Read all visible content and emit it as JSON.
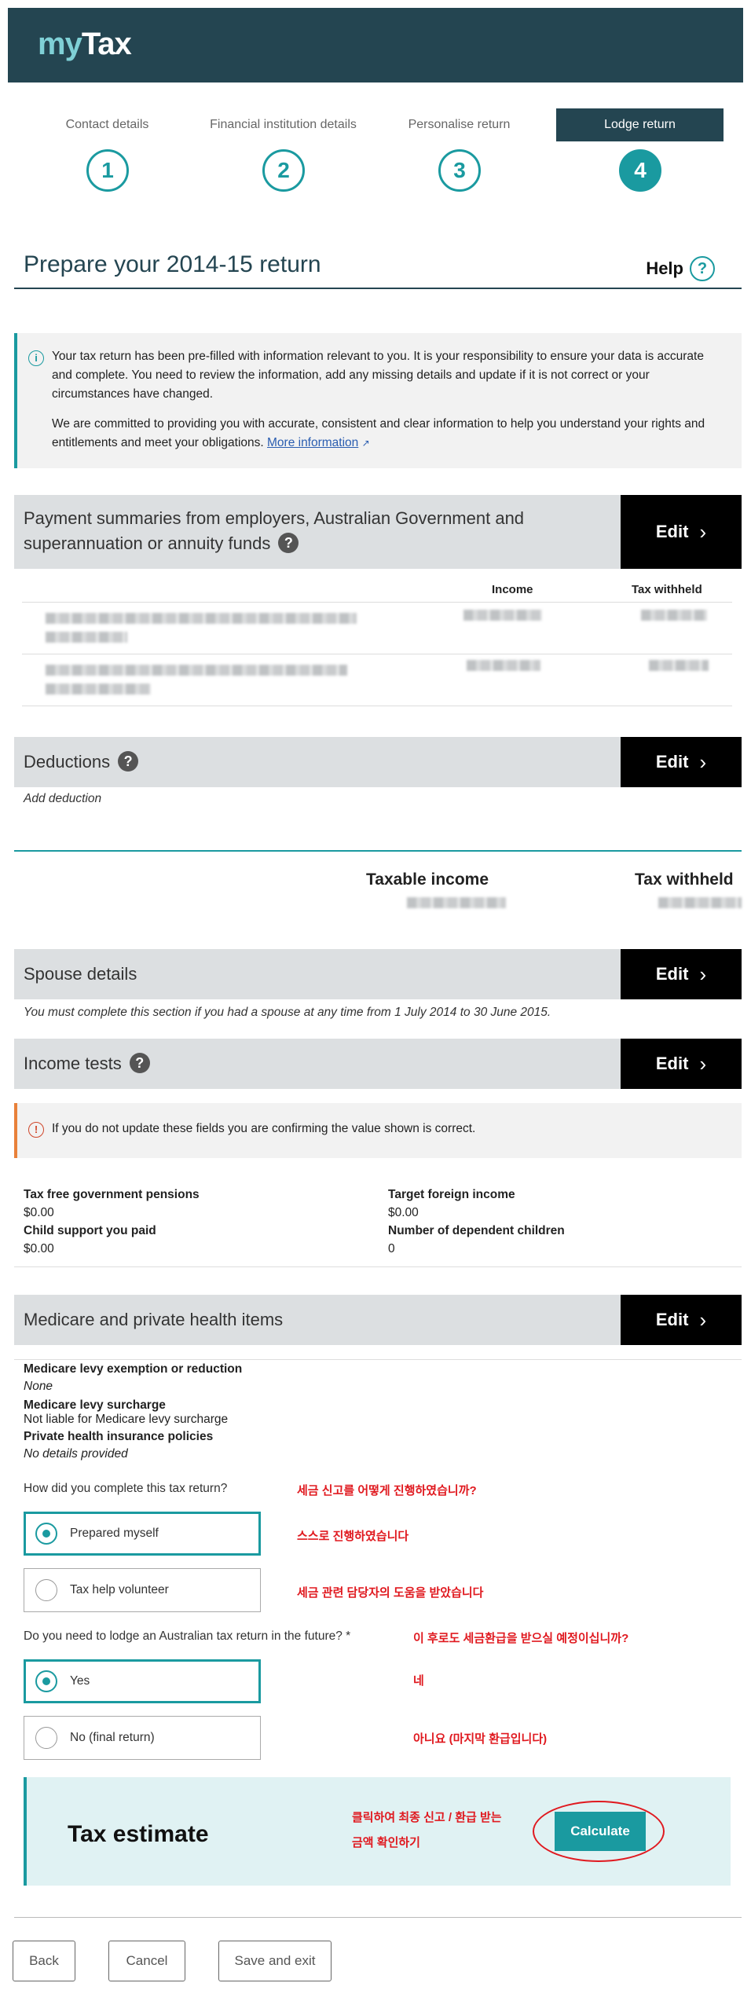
{
  "logo": {
    "my": "my",
    "tax": "Tax"
  },
  "steps": [
    {
      "label": "Contact details",
      "number": "1"
    },
    {
      "label": "Financial institution details",
      "number": "2"
    },
    {
      "label": "Personalise return",
      "number": "3"
    },
    {
      "label": "Lodge return",
      "number": "4"
    }
  ],
  "page": {
    "title": "Prepare your 2014-15 return",
    "help": "Help",
    "help_icon": "?"
  },
  "info": {
    "p1": "Your tax return has been pre-filled with information relevant to you. It is your responsibility to ensure your data is accurate and complete. You need to review the information, add any missing details and update if it is not correct or your circumstances have changed.",
    "p2": "We are committed to providing you with accurate, consistent and clear information to help you understand your rights and entitlements and meet your obligations.",
    "link": "More information"
  },
  "payment": {
    "title": "Payment summaries from employers, Australian Government and superannuation or annuity funds",
    "edit": "Edit",
    "col_income": "Income",
    "col_tax": "Tax withheld"
  },
  "deductions": {
    "title": "Deductions",
    "edit": "Edit",
    "add": "Add deduction"
  },
  "totals": {
    "taxable_income": "Taxable income",
    "tax_withheld": "Tax withheld"
  },
  "spouse": {
    "title": "Spouse details",
    "edit": "Edit",
    "note": "You must complete this section if you had a spouse at any time from 1 July 2014 to 30 June 2015."
  },
  "income_tests": {
    "title": "Income tests",
    "edit": "Edit",
    "warning": "If you do not update these fields you are confirming the value shown is correct.",
    "items": [
      {
        "label": "Tax free government pensions",
        "value": "$0.00"
      },
      {
        "label": "Target foreign income",
        "value": "$0.00"
      },
      {
        "label": "Child support you paid",
        "value": "$0.00"
      },
      {
        "label": "Number of dependent children",
        "value": "0"
      }
    ]
  },
  "medicare": {
    "title": "Medicare and private health items",
    "edit": "Edit",
    "items": [
      {
        "label": "Medicare levy exemption or reduction",
        "value": "None"
      },
      {
        "label": "Medicare levy surcharge",
        "value": "Not liable for Medicare levy surcharge"
      },
      {
        "label": "Private health insurance policies",
        "value": "No details provided"
      }
    ]
  },
  "q1": {
    "question": "How did you complete this tax return?",
    "opt1": "Prepared myself",
    "opt2": "Tax help volunteer",
    "k_question": "세금 신고를 어떻게 진행하였습니까?",
    "k_opt1": "스스로 진행하였습니다",
    "k_opt2": "세금 관련 담당자의 도움을 받았습니다"
  },
  "q2": {
    "question": "Do you need to lodge an Australian tax return in the future? *",
    "opt1": "Yes",
    "opt2": "No (final return)",
    "k_question": "이 후로도 세금환급을 받으실 예정이십니까?",
    "k_opt1": "네",
    "k_opt2": "아니요 (마지막 환급입니다)"
  },
  "estimate": {
    "title": "Tax estimate",
    "note_line1": "클릭하여 최종 신고 / 환급 받는",
    "note_line2": "금액 확인하기",
    "button": "Calculate"
  },
  "footer": {
    "back": "Back",
    "cancel": "Cancel",
    "save_exit": "Save and exit"
  }
}
